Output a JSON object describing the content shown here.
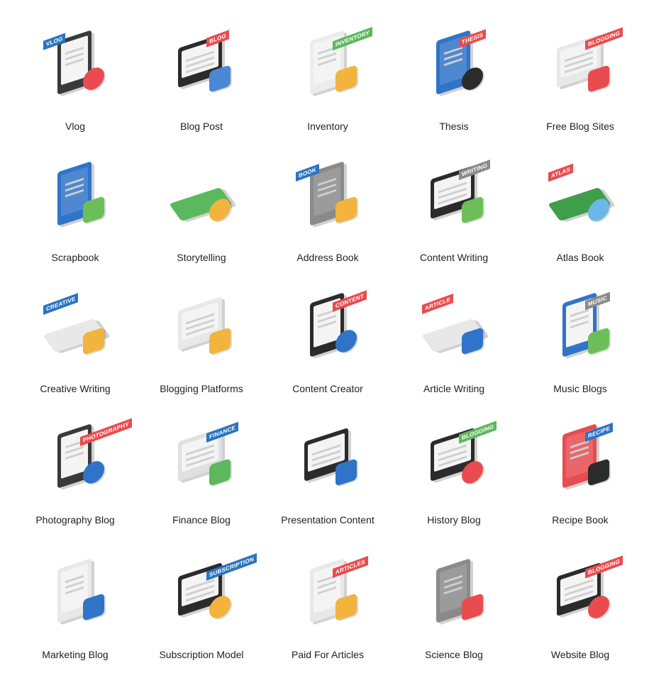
{
  "items": [
    {
      "label": "Vlog",
      "tag": "VLOG",
      "kind": "phone",
      "main": "#3a3a3a",
      "accent": "#e84c4f",
      "tag_color": "#2a74c0",
      "tag_side": "left"
    },
    {
      "label": "Blog Post",
      "tag": "BLOG",
      "kind": "laptop",
      "main": "#2b2b2b",
      "accent": "#4a88d6",
      "tag_color": "#e84c4f"
    },
    {
      "label": "Inventory",
      "tag": "INVENTORY",
      "kind": "doc",
      "main": "#ececec",
      "accent": "#f2b43c",
      "tag_color": "#5cb85c"
    },
    {
      "label": "Thesis",
      "tag": "THESIS",
      "kind": "book",
      "main": "#2f74c8",
      "accent": "#2b2b2b",
      "tag_color": "#e84c4f"
    },
    {
      "label": "Free Blog Sites",
      "tag": "BLOGGING",
      "kind": "monitor",
      "main": "#e8e8e8",
      "accent": "#e84c4f",
      "tag_color": "#e84c4f"
    },
    {
      "label": "Scrapbook",
      "tag": "",
      "kind": "book",
      "main": "#2f74c8",
      "accent": "#6cbf58"
    },
    {
      "label": "Storytelling",
      "tag": "",
      "kind": "flat",
      "main": "#5cb85c",
      "accent": "#f2b43c"
    },
    {
      "label": "Address Book",
      "tag": "BOOK",
      "kind": "book",
      "main": "#8a8a8a",
      "accent": "#f2b43c",
      "tag_color": "#2a74c0",
      "tag_side": "left"
    },
    {
      "label": "Content Writing",
      "tag": "WRITING",
      "kind": "laptop",
      "main": "#2b2b2b",
      "accent": "#6cbf58",
      "tag_color": "#8a8a8a"
    },
    {
      "label": "Atlas Book",
      "tag": "ATLAS",
      "kind": "flat",
      "main": "#3f9e4a",
      "accent": "#6cb6e8",
      "tag_color": "#e84c4f",
      "tag_side": "left"
    },
    {
      "label": "Creative Writing",
      "tag": "CREATIVE",
      "kind": "flat",
      "main": "#e8e8e8",
      "accent": "#f2b43c",
      "tag_color": "#2a74c0",
      "tag_side": "left"
    },
    {
      "label": "Blogging Platforms",
      "tag": "",
      "kind": "wide",
      "main": "#e8e8e8",
      "accent": "#f2b43c"
    },
    {
      "label": "Content Creator",
      "tag": "CONTENT",
      "kind": "doc",
      "main": "#2b2b2b",
      "accent": "#2f74c8",
      "tag_color": "#e84c4f"
    },
    {
      "label": "Article Writing",
      "tag": "ARTICLE",
      "kind": "flat",
      "main": "#e8e8e8",
      "accent": "#2f74c8",
      "tag_color": "#e84c4f",
      "tag_side": "left"
    },
    {
      "label": "Music Blogs",
      "tag": "MUSIC",
      "kind": "phone",
      "main": "#2f74c8",
      "accent": "#6cbf58",
      "tag_color": "#8a8a8a"
    },
    {
      "label": "Photography Blog",
      "tag": "PHOTOGRAPHY",
      "kind": "phone",
      "main": "#3a3a3a",
      "accent": "#2f74c8",
      "tag_color": "#e84c4f"
    },
    {
      "label": "Finance Blog",
      "tag": "FINANCE",
      "kind": "wide",
      "main": "#e0e0e0",
      "accent": "#5cb85c",
      "tag_color": "#2a74c0"
    },
    {
      "label": "Presentation Content",
      "tag": "",
      "kind": "wide",
      "main": "#2b2b2b",
      "accent": "#2f74c8"
    },
    {
      "label": "History Blog",
      "tag": "BLOGGING",
      "kind": "laptop",
      "main": "#2b2b2b",
      "accent": "#e84c4f",
      "tag_color": "#5cb85c"
    },
    {
      "label": "Recipe Book",
      "tag": "RECIPE",
      "kind": "book",
      "main": "#e84c4f",
      "accent": "#2b2b2b",
      "tag_color": "#2a74c0"
    },
    {
      "label": "Marketing Blog",
      "tag": "",
      "kind": "doc",
      "main": "#e8e8e8",
      "accent": "#2f74c8"
    },
    {
      "label": "Subscription Model",
      "tag": "SUBSCRIPTION",
      "kind": "laptop",
      "main": "#2b2b2b",
      "accent": "#f2b43c",
      "tag_color": "#2a74c0"
    },
    {
      "label": "Paid For Articles",
      "tag": "ARTICLES",
      "kind": "doc",
      "main": "#e8e8e8",
      "accent": "#f2b43c",
      "tag_color": "#e84c4f"
    },
    {
      "label": "Science Blog",
      "tag": "",
      "kind": "book",
      "main": "#8a8a8a",
      "accent": "#e84c4f"
    },
    {
      "label": "Website Blog",
      "tag": "BLOGGING",
      "kind": "laptop",
      "main": "#2b2b2b",
      "accent": "#e84c4f",
      "tag_color": "#e84c4f"
    }
  ]
}
